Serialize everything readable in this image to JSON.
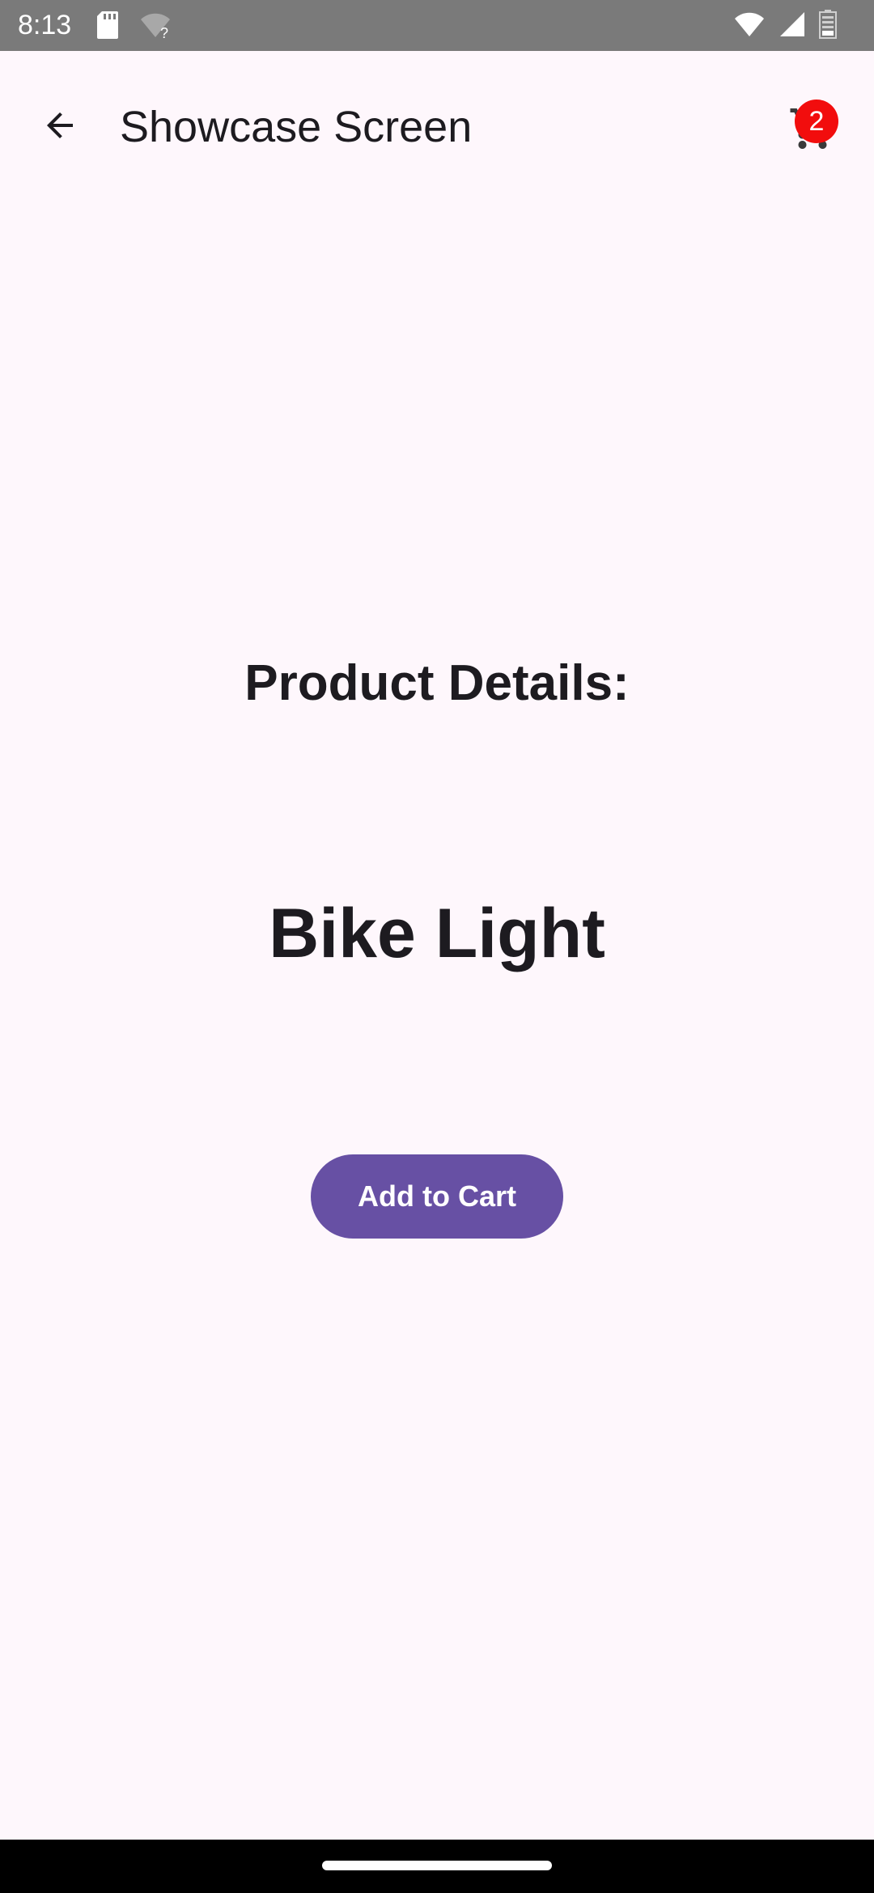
{
  "status_bar": {
    "time": "8:13",
    "left_icons": [
      "sd-card-icon",
      "wifi-question-icon"
    ],
    "right_icons": [
      "wifi-icon",
      "cellular-signal-icon",
      "battery-icon"
    ]
  },
  "app_bar": {
    "back_icon": "arrow-back-icon",
    "title": "Showcase Screen",
    "cart_icon": "shopping-cart-icon",
    "cart_count": "2"
  },
  "content": {
    "section_heading": "Product Details:",
    "product_name": "Bike Light",
    "add_to_cart_label": "Add to Cart"
  },
  "colors": {
    "background": "#fef7fc",
    "primary": "#6750a4",
    "badge": "#f20d0d",
    "status_bar": "#7a7a7a"
  }
}
